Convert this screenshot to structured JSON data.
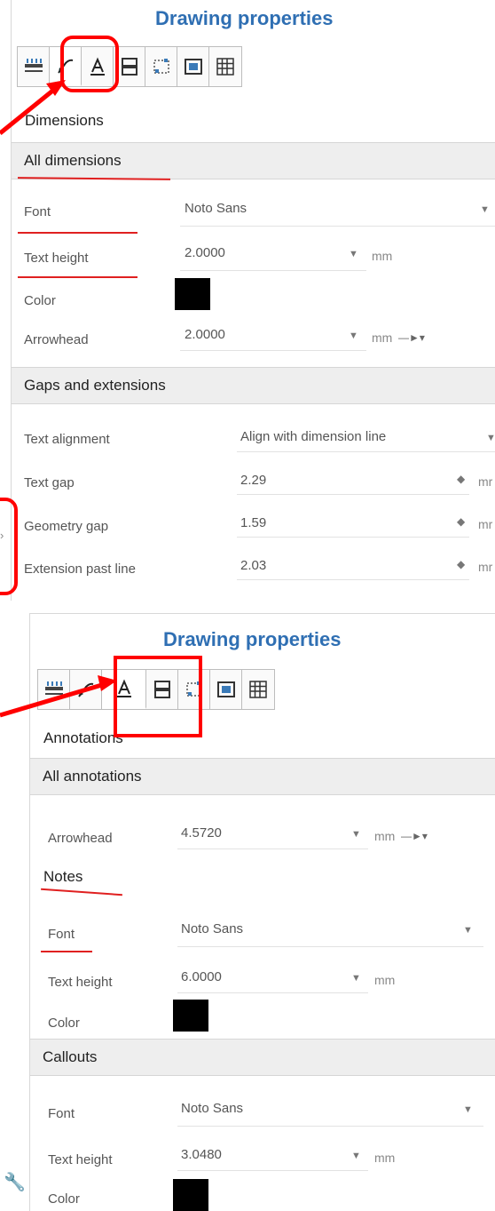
{
  "panel1": {
    "title": "Drawing properties",
    "section_title": "Dimensions",
    "toolbar": [
      {
        "icon": "dimension-ruler-icon",
        "active": false
      },
      {
        "icon": "dimension-arrow-icon",
        "active": true
      },
      {
        "icon": "text-annotation-icon",
        "active": false
      },
      {
        "icon": "table-layout-icon",
        "active": false
      },
      {
        "icon": "selection-box-icon",
        "active": false
      },
      {
        "icon": "view-frame-icon",
        "active": false
      },
      {
        "icon": "grid-icon",
        "active": false
      }
    ],
    "all_dimensions": {
      "heading": "All dimensions",
      "font_label": "Font",
      "font_value": "Noto Sans",
      "text_height_label": "Text height",
      "text_height_value": "2.0000",
      "text_height_unit": "mm",
      "color_label": "Color",
      "color_value": "#000000",
      "arrowhead_label": "Arrowhead",
      "arrowhead_value": "2.0000",
      "arrowhead_unit": "mm"
    },
    "gaps": {
      "heading": "Gaps and extensions",
      "text_alignment_label": "Text alignment",
      "text_alignment_value": "Align with dimension line",
      "text_gap_label": "Text gap",
      "text_gap_value": "2.29",
      "text_gap_unit": "mr",
      "geometry_gap_label": "Geometry gap",
      "geometry_gap_value": "1.59",
      "geometry_gap_unit": "mr",
      "extension_label": "Extension past line",
      "extension_value": "2.03",
      "extension_unit": "mr"
    }
  },
  "panel2": {
    "title": "Drawing properties",
    "section_title": "Annotations",
    "all_annotations": {
      "heading": "All annotations",
      "arrowhead_label": "Arrowhead",
      "arrowhead_value": "4.5720",
      "arrowhead_unit": "mm"
    },
    "notes": {
      "heading": "Notes",
      "font_label": "Font",
      "font_value": "Noto Sans",
      "text_height_label": "Text height",
      "text_height_value": "6.0000",
      "text_height_unit": "mm",
      "color_label": "Color",
      "color_value": "#000000"
    },
    "callouts": {
      "heading": "Callouts",
      "font_label": "Font",
      "font_value": "Noto Sans",
      "text_height_label": "Text height",
      "text_height_value": "3.0480",
      "text_height_unit": "mm",
      "color_label": "Color",
      "color_value": "#000000"
    }
  },
  "annotation_color": "#ff0000",
  "accent_color": "#2f6fb3"
}
